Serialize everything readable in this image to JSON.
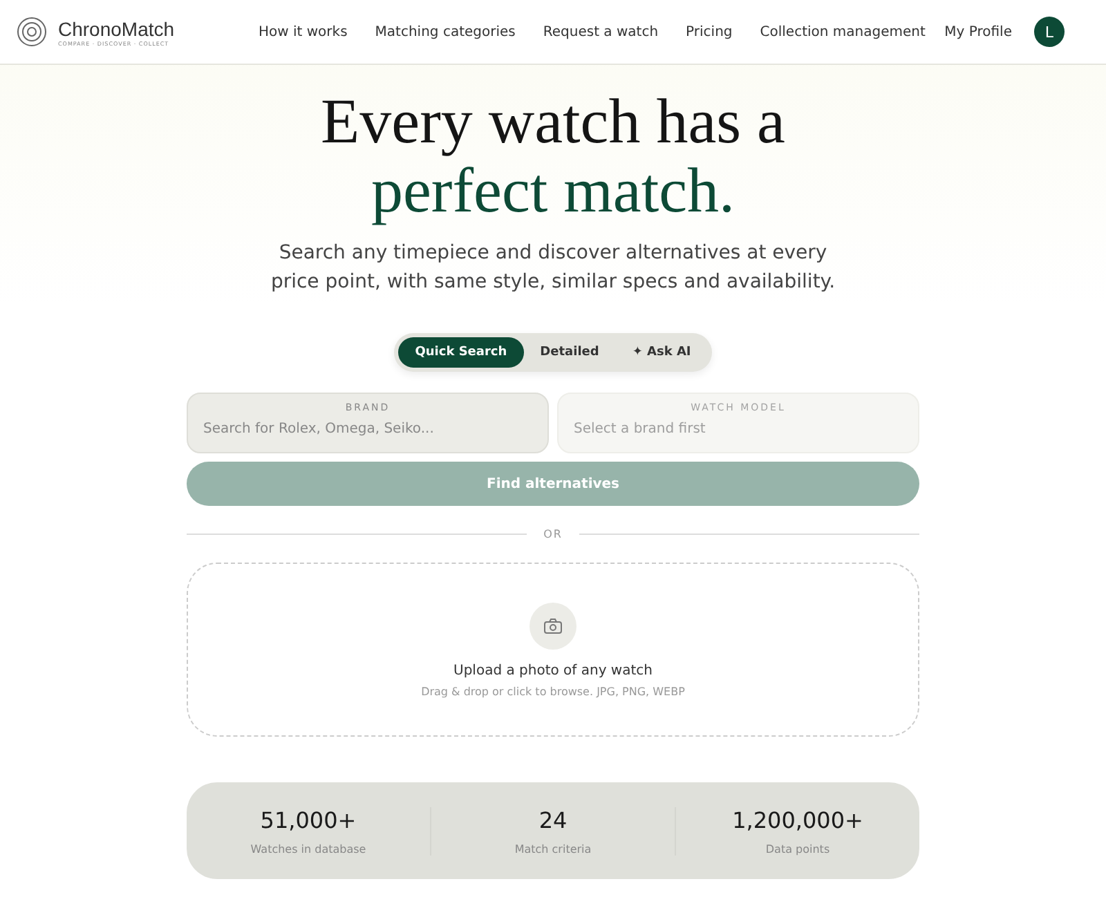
{
  "header": {
    "logo": "ChronoMatch",
    "tagline": "COMPARE · DISCOVER · COLLECT",
    "nav": [
      {
        "label": "How it works"
      },
      {
        "label": "Matching categories"
      },
      {
        "label": "Request a watch"
      },
      {
        "label": "Pricing"
      },
      {
        "label": "Collection management"
      }
    ],
    "profile": "My Profile",
    "avatar": "L"
  },
  "hero": {
    "title_line1": "Every watch has a",
    "title_line2": "perfect match.",
    "subtitle": "Search any timepiece and discover alternatives at every price point, with same style, similar specs and availability."
  },
  "tabs": [
    {
      "label": "Quick Search",
      "selected": true
    },
    {
      "label": "Detailed",
      "selected": false
    },
    {
      "label": "✦ Ask AI",
      "selected": false
    }
  ],
  "fields": [
    {
      "label": "BRAND",
      "placeholder": "Search for Rolex, Omega, Seiko...",
      "disabled": false
    },
    {
      "label": "WATCH MODEL",
      "placeholder": "Select a brand first",
      "disabled": true
    }
  ],
  "find_button": {
    "label": "Find alternatives",
    "disabled": true
  },
  "divider": "OR",
  "upload": {
    "title": "Upload a photo of any watch",
    "hint": "Drag & drop or click to browse. JPG, PNG, WEBP"
  },
  "stats": [
    {
      "value": "51,000+",
      "label": "Watches in database"
    },
    {
      "value": "24",
      "label": "Match criteria"
    },
    {
      "value": "1,200,000+",
      "label": "Data points"
    }
  ]
}
